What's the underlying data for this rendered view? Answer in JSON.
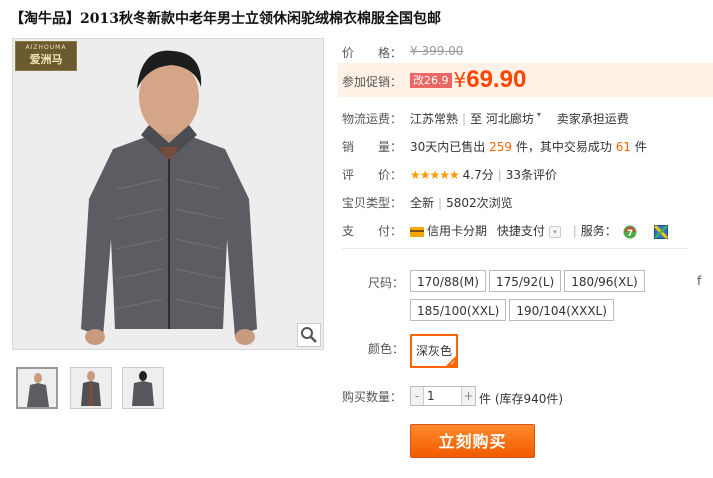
{
  "title": "【淘牛品】2013秋冬新款中老年男士立领休闲驼绒棉衣棉服全国包邮",
  "brand_logo": {
    "en": "AIZHOUMA",
    "cn": "爱洲马"
  },
  "price": {
    "label": "价　　格：",
    "value": "¥ 399.00"
  },
  "promo": {
    "label": "参加促销：",
    "tag": "改26.9",
    "currency": "¥",
    "value": "69.90"
  },
  "shipping": {
    "label": "物流运费：",
    "from": "江苏常熟",
    "to_prefix": "至",
    "to": "河北廊坊",
    "note": "卖家承担运费"
  },
  "sales": {
    "label": "销　　量：",
    "prefix": "30天内已售出",
    "count": "259",
    "unit1": "件，其中交易成功",
    "success": "61",
    "unit2": "件"
  },
  "rating": {
    "label": "评　　价：",
    "stars": "★★★★★",
    "score": "4.7分",
    "reviews": "33条评价"
  },
  "item_type": {
    "label": "宝贝类型：",
    "condition": "全新",
    "views": "5802次浏览"
  },
  "payment": {
    "label": "支　　付：",
    "credit": "信用卡分期",
    "fast_pay": "快捷支付",
    "more_icon": "▾",
    "service_label": "服务："
  },
  "size": {
    "label": "尺码：",
    "options": [
      "170/88(M)",
      "175/92(L)",
      "180/96(XL)",
      "185/100(XXL)",
      "190/104(XXXL)"
    ]
  },
  "color": {
    "label": "颜色：",
    "selected": "深灰色"
  },
  "quantity": {
    "label": "购买数量：",
    "minus": "-",
    "value": "1",
    "plus": "+",
    "stock": "件 (库存940件)"
  },
  "buy_button": "立刻购买",
  "right_edge_glyph": "f",
  "colors": {
    "accent": "#ff4400",
    "button": "#f25a00",
    "promo_bg": "#fff1e6"
  }
}
